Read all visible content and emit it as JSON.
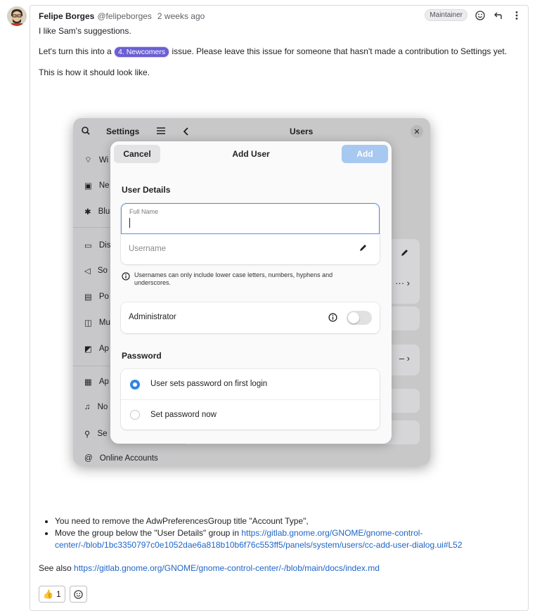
{
  "note": {
    "author_name": "Felipe Borges",
    "author_handle": "@felipeborges",
    "time": "2 weeks ago",
    "role_badge": "Maintainer",
    "line1": "I like Sam's suggestions.",
    "line2_before": "Let's turn this into a",
    "line2_label": "4. Newcomers",
    "line2_after": "issue. Please leave this issue for someone that hasn't made a contribution to Settings yet.",
    "line3": "This is how it should look like.",
    "bullet1": "You need to remove the AdwPreferencesGroup title \"Account Type\",",
    "bullet2_before": "Move the group below the \"User Details\" group in",
    "bullet2_link_a": "https://gitlab.gnome.org/GNOME/gnome-control-",
    "bullet2_link_b": "center/-/blob/1bc3350797c0e1052dae6a818b10b6f76c553ff5/panels/system/users/cc-add-user-dialog.ui#L52",
    "see_also_label": "See also",
    "see_also_link": "https://gitlab.gnome.org/GNOME/gnome-control-center/-/blob/main/docs/index.md",
    "thumbs_up_count": "1"
  },
  "screenshot": {
    "sidebar_title": "Settings",
    "content_title": "Users",
    "sidebar_items": [
      "Wi",
      "Ne",
      "Blu",
      "Dis",
      "So",
      "Po",
      "Mu",
      "Ap",
      "Ap",
      "No",
      "Se",
      "Online Accounts"
    ],
    "dialog": {
      "cancel_label": "Cancel",
      "title": "Add User",
      "add_label": "Add",
      "user_details_title": "User Details",
      "full_name_label": "Full Name",
      "username_placeholder": "Username",
      "username_hint": "Usernames can only include lower case letters, numbers, hyphens and underscores.",
      "administrator_label": "Administrator",
      "password_title": "Password",
      "option_first_login": "User sets password on first login",
      "option_set_now": "Set password now"
    }
  },
  "colors": {
    "label_purple": "#6b5fd3",
    "link_blue": "#1f65c7",
    "accent_blue": "#3584e4"
  }
}
